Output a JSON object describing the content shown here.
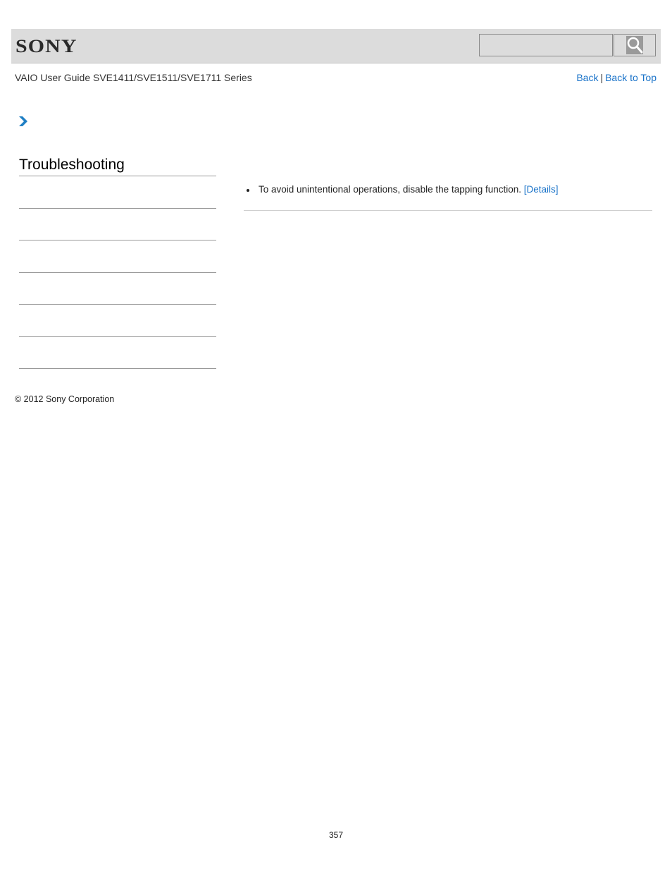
{
  "header": {
    "logo_text": "SONY",
    "search": {
      "placeholder": "",
      "value": "",
      "button_icon": "search-icon"
    }
  },
  "subheader": {
    "guide_title": "VAIO User Guide SVE1411/SVE1511/SVE1711 Series",
    "back_label": "Back",
    "separator": "|",
    "back_to_top_label": "Back to Top"
  },
  "breadcrumb": {
    "icon": "chevron-right-icon"
  },
  "sidebar": {
    "title": "Troubleshooting",
    "items": [
      "",
      "",
      "",
      "",
      "",
      ""
    ]
  },
  "content": {
    "items": [
      {
        "text": "To avoid unintentional operations, disable the tapping function. ",
        "link_label": "[Details]"
      }
    ]
  },
  "footer": {
    "copyright": "© 2012 Sony Corporation",
    "page_number": "357"
  },
  "colors": {
    "link": "#1a73c9",
    "header_bg": "#dcdcdc",
    "chevron": "#1f7fc4"
  }
}
